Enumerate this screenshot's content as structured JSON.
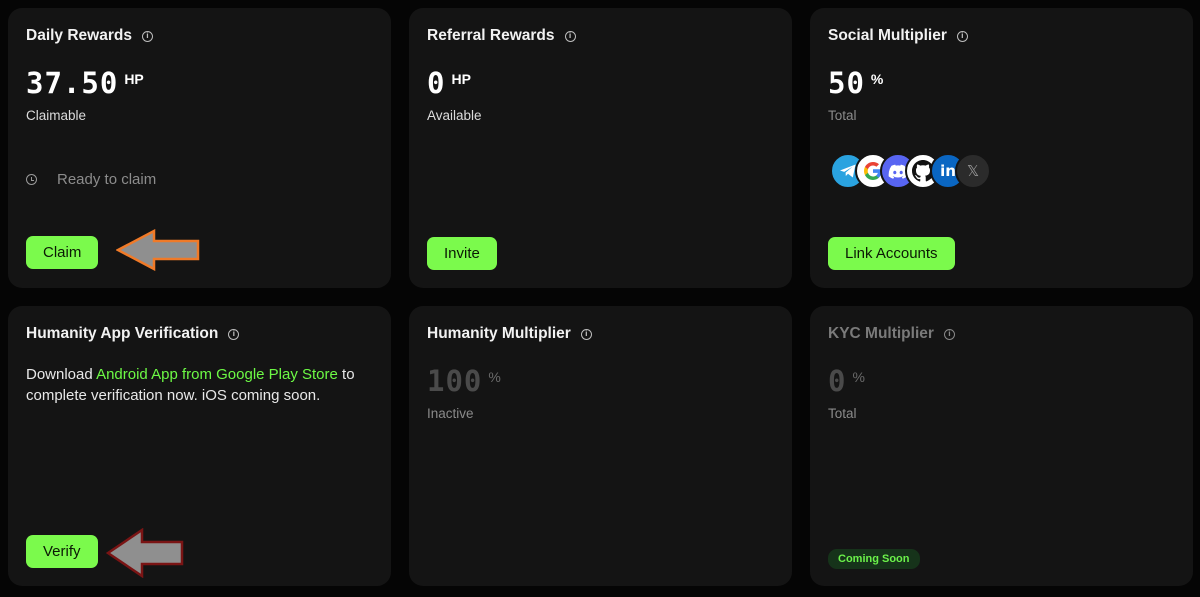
{
  "cards": {
    "daily": {
      "title": "Daily Rewards",
      "value": "37.50",
      "unit": "HP",
      "sub": "Claimable",
      "status": "Ready to claim",
      "button": "Claim"
    },
    "referral": {
      "title": "Referral Rewards",
      "value": "0",
      "unit": "HP",
      "sub": "Available",
      "button": "Invite"
    },
    "social": {
      "title": "Social Multiplier",
      "value": "50",
      "unit": "%",
      "sub": "Total",
      "icons": [
        "telegram-icon",
        "google-icon",
        "discord-icon",
        "github-icon",
        "linkedin-icon",
        "x-icon"
      ],
      "button": "Link Accounts"
    },
    "humanity_app": {
      "title": "Humanity App Verification",
      "desc_prefix": "Download ",
      "desc_link": "Android App from Google Play Store",
      "desc_suffix": " to complete verification now. iOS coming soon.",
      "button": "Verify"
    },
    "humanity_mult": {
      "title": "Humanity Multiplier",
      "value": "100",
      "unit": "%",
      "sub": "Inactive"
    },
    "kyc": {
      "title": "KYC Multiplier",
      "value": "0",
      "unit": "%",
      "sub": "Total",
      "badge": "Coming Soon"
    }
  },
  "colors": {
    "accent_green": "#7bfa4c",
    "card_bg": "#141414",
    "page_bg": "#050505",
    "arrow_orange": "#f07a28",
    "arrow_darkred": "#7a1414"
  }
}
